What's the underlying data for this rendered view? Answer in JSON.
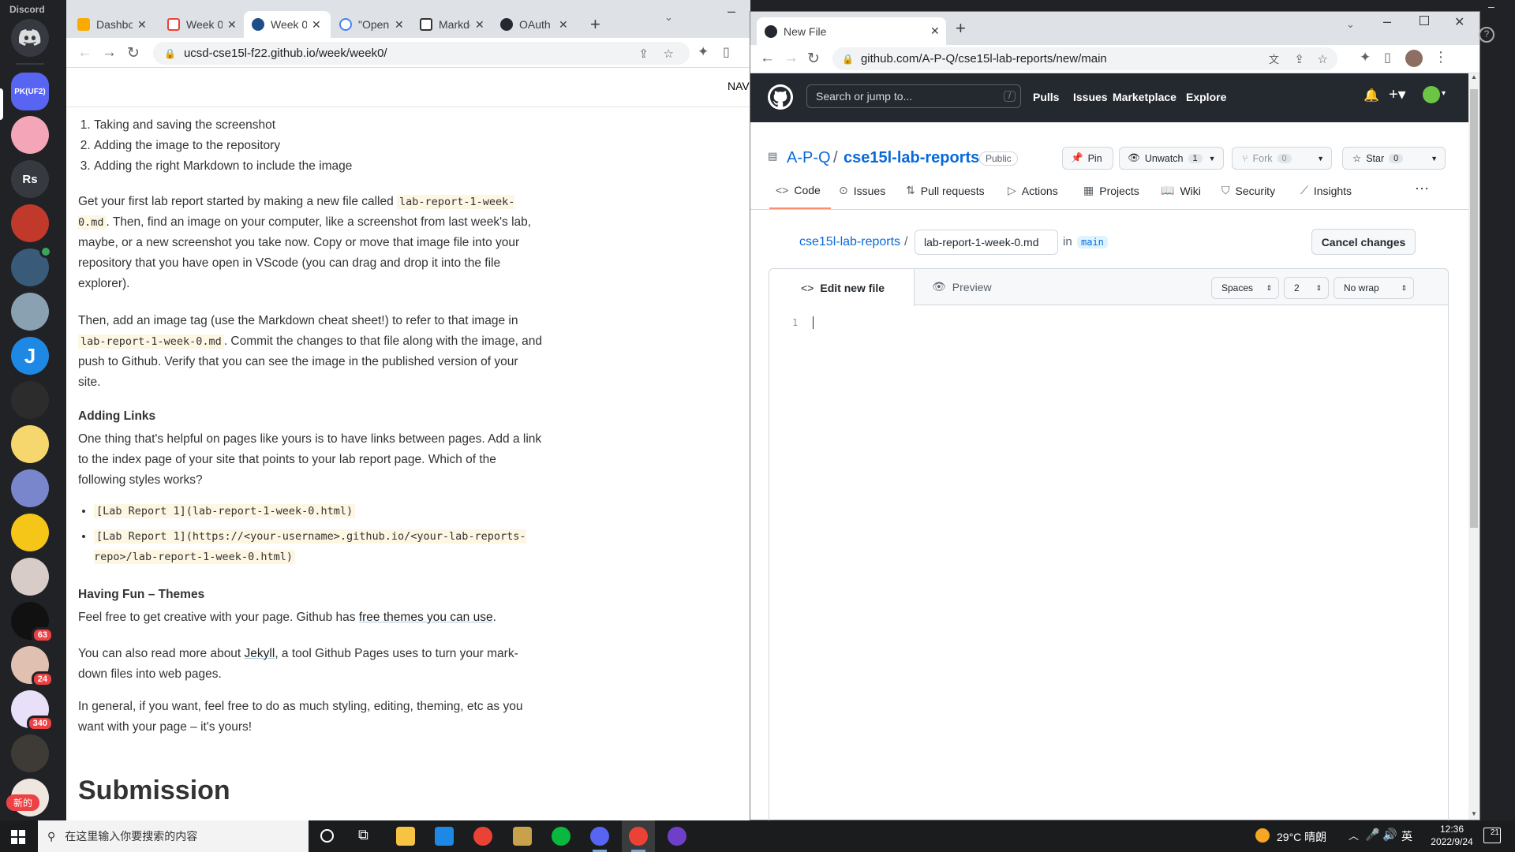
{
  "discord": {
    "title": "Discord",
    "servers": [
      {
        "label": "PK(UF2)",
        "color": "#5865f2"
      },
      {
        "label": "",
        "color": "#f4a6b8"
      },
      {
        "label": "Rs",
        "color": "#36393f"
      },
      {
        "label": "",
        "color": "#c0392b"
      },
      {
        "label": "",
        "color": "#3a5a7a"
      },
      {
        "label": "",
        "color": "#8aa1b1"
      },
      {
        "label": "",
        "color": "#1e88e5"
      },
      {
        "label": "",
        "color": "#2c2c2c"
      },
      {
        "label": "",
        "color": "#f5d76e"
      },
      {
        "label": "",
        "color": "#7986cb"
      },
      {
        "label": "",
        "color": "#f5c518"
      },
      {
        "label": "",
        "color": "#d7ccc8"
      },
      {
        "label": "",
        "color": "#111111"
      },
      {
        "label": "",
        "color": "#e0c0b0"
      },
      {
        "label": "",
        "color": "#e8e0f8"
      },
      {
        "label": "",
        "color": "#3e3a36"
      },
      {
        "label": "",
        "color": "#f0e6e0"
      }
    ],
    "badges": {
      "b63": "63",
      "b24": "24",
      "b340": "340"
    },
    "new_label": "新的"
  },
  "left_browser": {
    "tabs": [
      "Dashbo",
      "Week 0",
      "Week 0",
      "\"Open",
      "Markdo",
      "OAuth a"
    ],
    "url": "ucsd-cse15l-f22.github.io/week/week0/",
    "nav_text": "NAV",
    "list": [
      "Taking and saving the screenshot",
      "Adding the image to the repository",
      "Adding the right Markdown to include the image"
    ],
    "p1_a": "Get your first lab report started by making a new file called ",
    "p1_code": "lab-report-1-week-0.md",
    "p1_b": ". Then, find an image on your computer, like a screenshot from last week's lab, maybe, or a new screenshot you take now. Copy or move that image file into your repository that you have open in VScode (you can drag and drop it into the file explorer).",
    "p2_a": "Then, add an image tag (use the Markdown cheat sheet!) to refer to that image in ",
    "p2_code": "lab-report-1-week-0.md",
    "p2_b": ". Commit the changes to that file along with the image, and push to Github. Verify that you can see the image in the published version of your site.",
    "h_links": "Adding Links",
    "p3": "One thing that's helpful on pages like yours is to have links between pages. Add a link to the index page of your site that points to your lab report page. Which of the following styles works?",
    "bullet1": "[Lab Report 1](lab-report-1-week-0.html)",
    "bullet2": "[Lab Report 1](https://<your-username>.github.io/<your-lab-reports-repo>/lab-report-1-week-0.html)",
    "h_themes": "Having Fun – Themes",
    "p4_a": "Feel free to get creative with your page. Github has ",
    "p4_link": "free themes you can use",
    "p4_b": ".",
    "p5_a": "You can also read more about ",
    "p5_link": "Jekyll",
    "p5_b": ", a tool Github Pages uses to turn your mark-down files into web pages.",
    "p6": "In general, if you want, feel free to do as much styling, editing, theming, etc as you want with your page – it's yours!",
    "h_submission": "Submission"
  },
  "right_browser": {
    "tab_title": "New File",
    "url": "github.com/A-P-Q/cse15l-lab-reports/new/main",
    "search_placeholder": "Search or jump to...",
    "search_key": "/",
    "nav": [
      "Pulls",
      "Issues",
      "Marketplace",
      "Explore"
    ],
    "owner": "A-P-Q",
    "repo": "cse15l-lab-reports",
    "visibility": "Public",
    "pin": "Pin",
    "unwatch": "Unwatch",
    "unwatch_count": "1",
    "fork": "Fork",
    "fork_count": "0",
    "star": "Star",
    "star_count": "0",
    "repo_tabs": [
      "Code",
      "Issues",
      "Pull requests",
      "Actions",
      "Projects",
      "Wiki",
      "Security",
      "Insights"
    ],
    "breadcrumb_repo": "cse15l-lab-reports",
    "filename": "lab-report-1-week-0.md",
    "in_label": "in",
    "branch": "main",
    "cancel": "Cancel changes",
    "edit_tab": "Edit new file",
    "preview_tab": "Preview",
    "indent_mode": "Spaces",
    "indent_size": "2",
    "wrap_mode": "No wrap",
    "line_number": "1"
  },
  "taskbar": {
    "search_placeholder": "在这里输入你要搜索的内容",
    "weather": "29°C 晴朗",
    "ime": "英",
    "time": "12:36",
    "date": "2022/9/24",
    "notif": "21"
  }
}
